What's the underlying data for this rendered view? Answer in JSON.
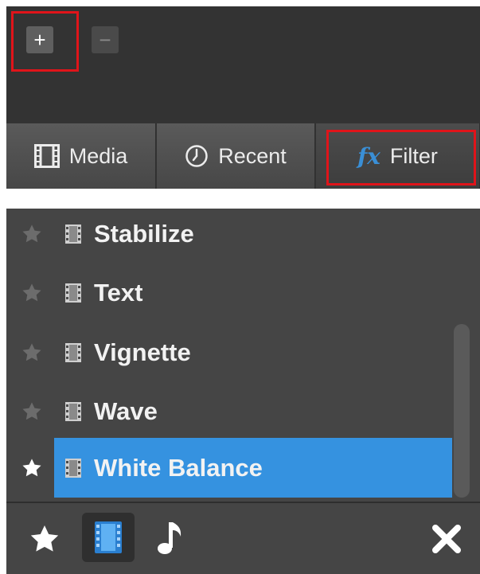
{
  "toolbar": {
    "add_label": "+",
    "remove_label": "−"
  },
  "tabs": [
    {
      "label": "Media",
      "icon": "film-icon"
    },
    {
      "label": "Recent",
      "icon": "clock-icon"
    },
    {
      "label": "Filter",
      "icon": "fx-icon",
      "icon_text": "fx"
    }
  ],
  "filters": [
    {
      "label": "Stabilize",
      "favorite": false,
      "selected": false
    },
    {
      "label": "Text",
      "favorite": false,
      "selected": false
    },
    {
      "label": "Vignette",
      "favorite": false,
      "selected": false
    },
    {
      "label": "Wave",
      "favorite": false,
      "selected": false
    },
    {
      "label": "White Balance",
      "favorite": true,
      "selected": true
    }
  ],
  "bottom_bar": {
    "icons": [
      "star-icon",
      "video-filter-icon",
      "music-note-icon",
      "close-icon"
    ]
  },
  "colors": {
    "highlight_box": "#e0141a",
    "selection": "#3592e0",
    "fx_accent": "#3a8fd6",
    "panel_bg": "#454545"
  }
}
